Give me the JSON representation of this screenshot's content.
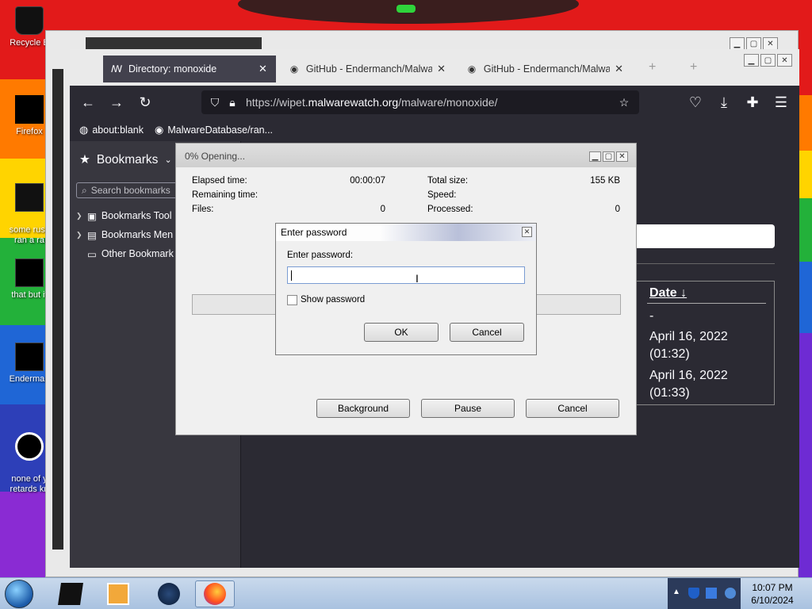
{
  "desktop": {
    "icons": [
      {
        "label": "Recycle B"
      },
      {
        "label": "Firefox"
      },
      {
        "label": "some russ\nran a ra"
      },
      {
        "label": "that but it"
      },
      {
        "label": "Enderman"
      },
      {
        "label": "none of y\nretards kn"
      }
    ]
  },
  "browser": {
    "tabs": [
      {
        "label": "Directory: monoxide",
        "active": true
      },
      {
        "label": "GitHub - Endermanch/Malware",
        "active": false
      },
      {
        "label": "GitHub - Endermanch/Malware",
        "active": false
      }
    ],
    "url_prefix": "https://wipet.",
    "url_domain": "malwarewatch.org",
    "url_path": "/malware/monoxide/",
    "bookmarks_bar": [
      {
        "label": "about:blank"
      },
      {
        "label": "MalwareDatabase/ran..."
      }
    ],
    "sidebar": {
      "title": "Bookmarks",
      "search_placeholder": "Search bookmarks",
      "items": [
        {
          "label": "Bookmarks Tool"
        },
        {
          "label": "Bookmarks Men"
        },
        {
          "label": "Other Bookmark"
        }
      ]
    },
    "table": {
      "header": "Date ↓",
      "rows": [
        "-",
        "April 16, 2022\n(01:32)",
        "April 16, 2022\n(01:33)"
      ]
    }
  },
  "progress_dialog": {
    "title": "0% Opening...",
    "elapsed_label": "Elapsed time:",
    "elapsed_value": "00:00:07",
    "remaining_label": "Remaining time:",
    "files_label": "Files:",
    "files_value": "0",
    "total_size_label": "Total size:",
    "total_size_value": "155 KB",
    "speed_label": "Speed:",
    "processed_label": "Processed:",
    "processed_value": "0",
    "background_button": "Background",
    "pause_button": "Pause",
    "cancel_button": "Cancel"
  },
  "password_dialog": {
    "title": "Enter password",
    "prompt": "Enter password:",
    "value": "",
    "show_password_label": "Show password",
    "ok_button": "OK",
    "cancel_button": "Cancel"
  },
  "taskbar": {
    "time": "10:07 PM",
    "date": "6/10/2024"
  }
}
